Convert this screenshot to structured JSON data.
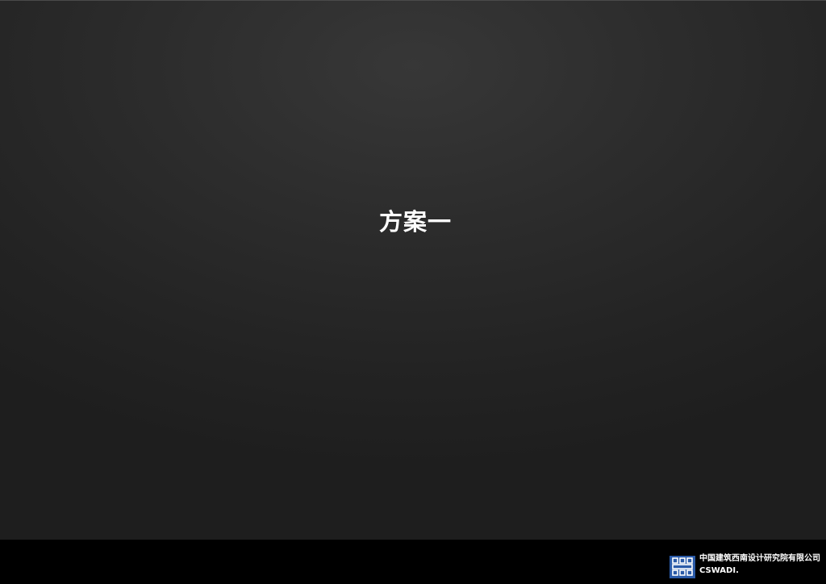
{
  "slide": {
    "title": "方案一"
  },
  "footer": {
    "logo_icon": "cswadi-logo-icon",
    "company_name_cn": "中国建筑西南设计研究院有限公司",
    "company_name_en": "CSWADI."
  },
  "colors": {
    "background": "#2c2c2c",
    "footer_bar": "#000000",
    "logo_blue": "#2a5aa8",
    "text": "#ffffff"
  }
}
